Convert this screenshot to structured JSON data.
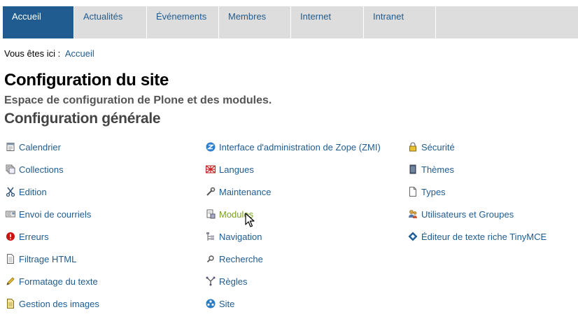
{
  "nav": {
    "tabs": [
      {
        "label": "Accueil",
        "active": true
      },
      {
        "label": "Actualités"
      },
      {
        "label": "Événements"
      },
      {
        "label": "Membres"
      },
      {
        "label": "Internet"
      },
      {
        "label": "Intranet"
      }
    ]
  },
  "breadcrumb": {
    "prefix": "Vous êtes ici :",
    "current": "Accueil"
  },
  "page": {
    "title": "Configuration du site",
    "description": "Espace de configuration de Plone et des modules.",
    "section_title": "Configuration générale"
  },
  "config": {
    "col1": [
      {
        "label": "Calendrier",
        "icon": "calendar-icon"
      },
      {
        "label": "Collections",
        "icon": "collections-icon"
      },
      {
        "label": "Edition",
        "icon": "scissors-icon"
      },
      {
        "label": "Envoi de courriels",
        "icon": "mail-icon"
      },
      {
        "label": "Erreurs",
        "icon": "error-icon"
      },
      {
        "label": "Filtrage HTML",
        "icon": "document-icon"
      },
      {
        "label": "Formatage du texte",
        "icon": "pencil-icon"
      },
      {
        "label": "Gestion des images",
        "icon": "image-icon"
      }
    ],
    "col2": [
      {
        "label": "Interface d'administration de Zope (ZMI)",
        "icon": "zope-icon"
      },
      {
        "label": "Langues",
        "icon": "flag-icon"
      },
      {
        "label": "Maintenance",
        "icon": "wrench-icon"
      },
      {
        "label": "Modules",
        "icon": "modules-icon",
        "hovered": true
      },
      {
        "label": "Navigation",
        "icon": "sitemap-icon"
      },
      {
        "label": "Recherche",
        "icon": "search-icon"
      },
      {
        "label": "Règles",
        "icon": "rules-icon"
      },
      {
        "label": "Site",
        "icon": "site-icon"
      }
    ],
    "col3": [
      {
        "label": "Sécurité",
        "icon": "lock-icon"
      },
      {
        "label": "Thèmes",
        "icon": "theme-icon"
      },
      {
        "label": "Types",
        "icon": "types-icon"
      },
      {
        "label": "Utilisateurs et Groupes",
        "icon": "users-icon"
      },
      {
        "label": "Éditeur de texte riche TinyMCE",
        "icon": "tinymce-icon"
      }
    ]
  },
  "colors": {
    "nav_active": "#205c90",
    "nav_bg": "#dddddd",
    "link": "#205c90",
    "link_hover": "#7aa11f"
  }
}
